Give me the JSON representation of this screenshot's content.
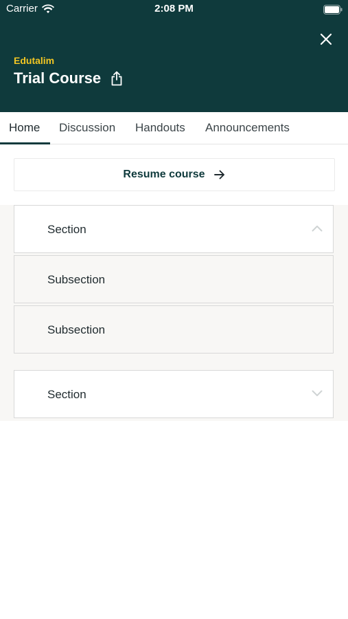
{
  "status_bar": {
    "carrier": "Carrier",
    "time": "2:08 PM"
  },
  "header": {
    "org": "Edutalim",
    "course_title": "Trial Course"
  },
  "tabs": [
    {
      "label": "Home",
      "active": true
    },
    {
      "label": "Discussion",
      "active": false
    },
    {
      "label": "Handouts",
      "active": false
    },
    {
      "label": "Announcements",
      "active": false
    }
  ],
  "resume": {
    "label": "Resume course"
  },
  "outline": [
    {
      "label": "Section",
      "expanded": true,
      "subsections": [
        {
          "label": "Subsection"
        },
        {
          "label": "Subsection"
        }
      ]
    },
    {
      "label": "Section",
      "expanded": false,
      "subsections": []
    }
  ],
  "colors": {
    "header_bg": "#0f3a3c",
    "org_accent": "#f3c623",
    "page_bg": "#ffffff",
    "outline_bg": "#f8f7f5"
  },
  "icons": {
    "wifi": "wifi-icon",
    "battery": "battery-icon",
    "close": "close-icon",
    "share": "share-icon",
    "resume_arrow": "arrow-right-icon",
    "expanded": "chevron-up-icon",
    "collapsed": "chevron-down-icon"
  }
}
